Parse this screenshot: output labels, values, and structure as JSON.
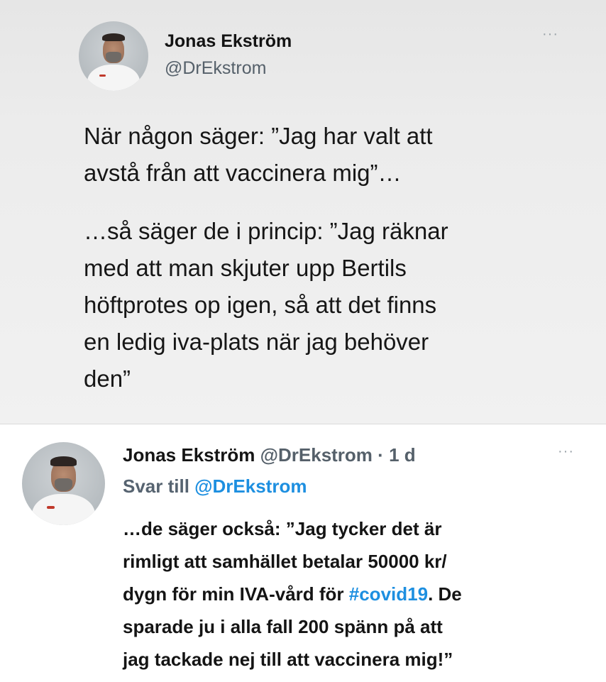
{
  "main_tweet": {
    "author_name": "Jonas Ekström",
    "author_handle": "@DrEkstrom",
    "more_icon": "more-horizontal-icon",
    "paragraph1_lines": [
      "När någon säger: ”Jag har valt att",
      "avstå från att vaccinera mig”…"
    ],
    "paragraph2_lines": [
      "…så säger de i princip: ”Jag räknar",
      "med att man skjuter upp Bertils",
      "höftprotes op igen, så att det finns",
      "en ledig iva-plats när jag behöver",
      "den”"
    ]
  },
  "reply_tweet": {
    "author_name": "Jonas Ekström",
    "author_handle": "@DrEkstrom",
    "separator": "·",
    "time": "1 d",
    "reply_to_label": "Svar till",
    "reply_to_handle": "@DrEkstrom",
    "more_icon": "more-horizontal-icon",
    "line1": "…de säger också: ”Jag tycker det är",
    "line2": "rimligt att samhället betalar 50000 kr/",
    "line3_before": "dygn för min IVA-vård för ",
    "line3_hashtag": "#covid19",
    "line3_after": ". De",
    "line4": "sparade ju i alla fall 200 spänn på att",
    "line5": "jag tackade nej till att vaccinera mig!”"
  },
  "colors": {
    "hashtag": "#1d8fe0",
    "secondary_text": "#55606a",
    "main_background": "#ececec",
    "reply_background": "#ffffff"
  }
}
